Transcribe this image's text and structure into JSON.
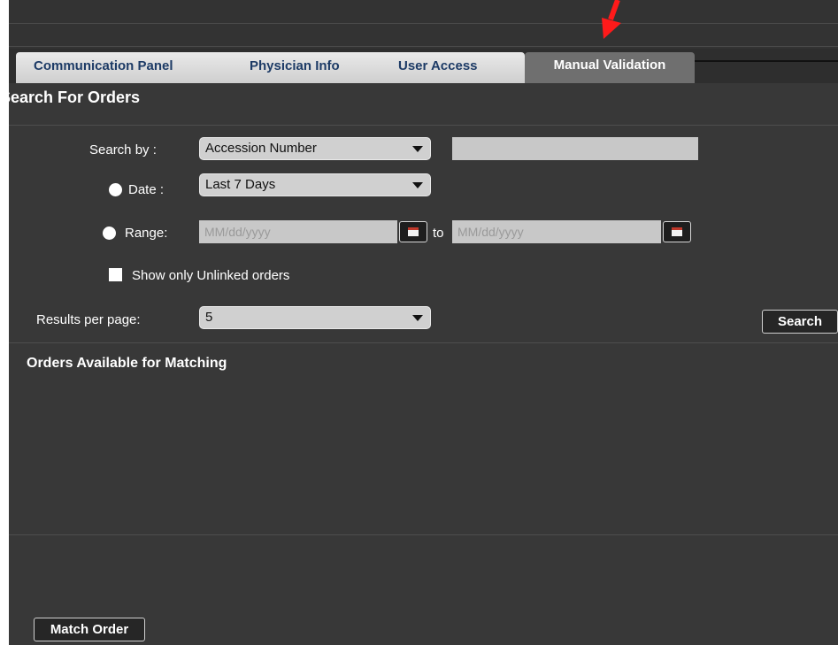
{
  "tabs": [
    {
      "label": "Communication Panel"
    },
    {
      "label": "Physician Info"
    },
    {
      "label": "User Access"
    },
    {
      "label": "Manual Validation",
      "active": true
    }
  ],
  "search_section": {
    "title": "Search For Orders",
    "search_by_label": "Search by :",
    "search_by_value": "Accession Number",
    "search_value": "",
    "date_label": "Date :",
    "date_value": "Last 7 Days",
    "range_label": "Range:",
    "range_from_placeholder": "MM/dd/yyyy",
    "range_to_label": "to",
    "range_to_placeholder": "MM/dd/yyyy",
    "unlinked_label": "Show only Unlinked orders",
    "results_label": "Results per page:",
    "results_value": "5",
    "search_button": "Search"
  },
  "orders_section": {
    "title": "Orders Available for Matching",
    "match_button": "Match Order"
  },
  "colors": {
    "background": "#383838",
    "tab_text": "#1d3b66",
    "annotation_arrow": "#ff1a1a"
  }
}
